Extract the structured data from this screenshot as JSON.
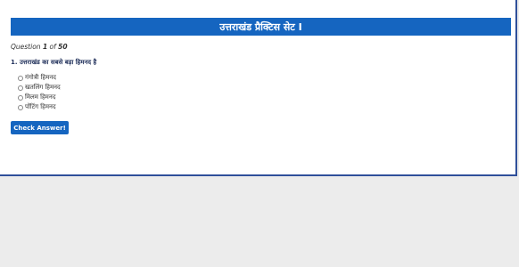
{
  "banner": {
    "title": "उत्तराखंड प्रैक्टिस सेट I"
  },
  "counter": {
    "prefix": "Question",
    "current": "1",
    "of_word": "of",
    "total": "50"
  },
  "question": {
    "text": "1. उत्तराखंड का सबसे बड़ा हिमनद है"
  },
  "options": [
    {
      "label": "गंगोत्री हिमनद"
    },
    {
      "label": "खतलिंग हिमनद"
    },
    {
      "label": "मिलम हिमनद"
    },
    {
      "label": "पोंटिंग हिमनद"
    }
  ],
  "actions": {
    "check_label": "Check Answer!"
  },
  "colors": {
    "accent": "#1565c0",
    "frame_border": "#2f4f9a",
    "page_bg": "#ececec"
  }
}
